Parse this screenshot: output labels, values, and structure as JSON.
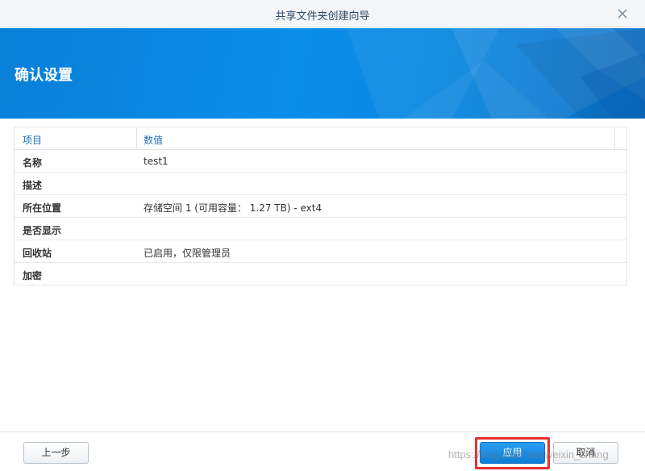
{
  "window": {
    "title": "共享文件夹创建向导",
    "close_icon": "close-icon"
  },
  "banner": {
    "heading": "确认设置",
    "color": "#0b8ee8"
  },
  "table": {
    "headers": [
      "项目",
      "数值"
    ],
    "rows": [
      {
        "key": "名称",
        "value": "test1"
      },
      {
        "key": "描述",
        "value": ""
      },
      {
        "key": "所在位置",
        "value": "存储空间 1 (可用容量： 1.27 TB) - ext4"
      },
      {
        "key": "是否显示",
        "value": ""
      },
      {
        "key": "回收站",
        "value": "已启用，仅限管理员"
      },
      {
        "key": "加密",
        "value": ""
      }
    ]
  },
  "footer": {
    "prev_label": "上一步",
    "apply_label": "应用",
    "cancel_label": "取消",
    "highlight_color": "#e53030",
    "watermark": "https://blog.csdn.net/weixin_zhang"
  }
}
